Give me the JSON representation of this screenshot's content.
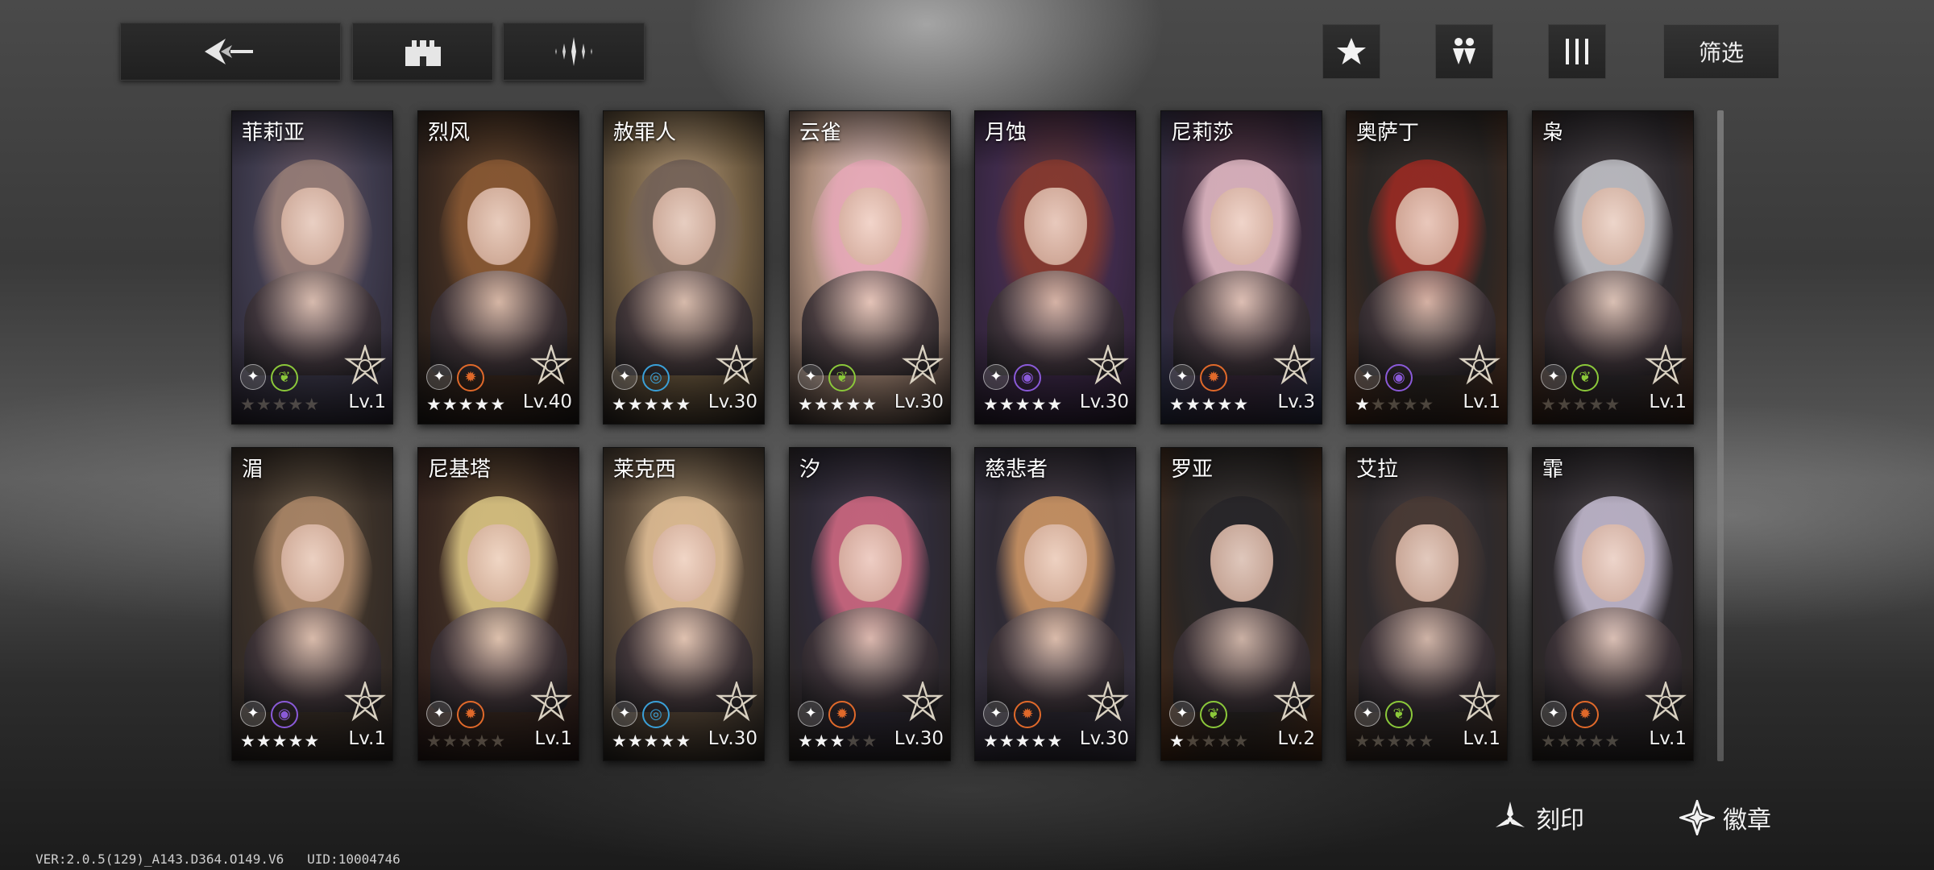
{
  "toolbar": {
    "back_icon": "back-arrow-icon",
    "team_icon": "castle-icon",
    "formation_icon": "sparkle-icon",
    "favorite_icon": "star-icon",
    "sort_icon": "figures-icon",
    "columns_icon": "columns-icon",
    "filter_label": "筛选"
  },
  "characters": [
    {
      "name": "菲莉亚",
      "stars": 5,
      "stars_filled": 0,
      "level": "Lv.1",
      "element": "nature",
      "palette": [
        "#6c5a66",
        "#3d3a4c",
        "#2a2532"
      ],
      "hair": "#9a8078"
    },
    {
      "name": "烈风",
      "stars": 5,
      "stars_filled": 5,
      "level": "Lv.40",
      "element": "fire",
      "palette": [
        "#6a4a30",
        "#3b2a20",
        "#1f1a18"
      ],
      "hair": "#8c5a34"
    },
    {
      "name": "赦罪人",
      "stars": 5,
      "stars_filled": 5,
      "level": "Lv.30",
      "element": "water",
      "palette": [
        "#b59a7a",
        "#6d5a40",
        "#2a2420"
      ],
      "hair": "#6f5e56"
    },
    {
      "name": "云雀",
      "stars": 5,
      "stars_filled": 5,
      "level": "Lv.30",
      "element": "nature",
      "palette": [
        "#e6c6c8",
        "#a88a78",
        "#3a302c"
      ],
      "hair": "#e7a7b7"
    },
    {
      "name": "月蚀",
      "stars": 5,
      "stars_filled": 5,
      "level": "Lv.30",
      "element": "dark",
      "palette": [
        "#6a3a38",
        "#3e2a4a",
        "#2a2030"
      ],
      "hair": "#8a3a2e"
    },
    {
      "name": "尼莉莎",
      "stars": 5,
      "stars_filled": 5,
      "level": "Lv.3",
      "element": "fire",
      "palette": [
        "#5a3a48",
        "#3a2a3c",
        "#2a3048"
      ],
      "hair": "#e9c0cb"
    },
    {
      "name": "奥萨丁",
      "stars": 5,
      "stars_filled": 1,
      "level": "Lv.1",
      "element": "dark",
      "palette": [
        "#3a3230",
        "#2a2624",
        "#4a2a1a"
      ],
      "hair": "#a02a22"
    },
    {
      "name": "枭",
      "stars": 5,
      "stars_filled": 0,
      "level": "Lv.1",
      "element": "nature",
      "palette": [
        "#4a4448",
        "#2e2a2e",
        "#3a2418"
      ],
      "hair": "#c9c9cf"
    },
    {
      "name": "湄",
      "stars": 5,
      "stars_filled": 5,
      "level": "Lv.1",
      "element": "dark",
      "palette": [
        "#6a5a48",
        "#3a3028",
        "#2a2422"
      ],
      "hair": "#b08a6a"
    },
    {
      "name": "尼基塔",
      "stars": 5,
      "stars_filled": 0,
      "level": "Lv.1",
      "element": "fire",
      "palette": [
        "#6a5238",
        "#3a2a22",
        "#2a1a18"
      ],
      "hair": "#e2cc88"
    },
    {
      "name": "莱克西",
      "stars": 5,
      "stars_filled": 5,
      "level": "Lv.30",
      "element": "water",
      "palette": [
        "#a89070",
        "#5a4a3a",
        "#2a2622"
      ],
      "hair": "#e2bf96"
    },
    {
      "name": "汐",
      "stars": 5,
      "stars_filled": 3,
      "level": "Lv.30",
      "element": "fire",
      "palette": [
        "#4a4050",
        "#2e2a36",
        "#2a2420"
      ],
      "hair": "#d66a84"
    },
    {
      "name": "慈悲者",
      "stars": 5,
      "stars_filled": 5,
      "level": "Lv.30",
      "element": "fire",
      "palette": [
        "#4a4048",
        "#2e2a34",
        "#3a3444"
      ],
      "hair": "#d49a66"
    },
    {
      "name": "罗亚",
      "stars": 5,
      "stars_filled": 1,
      "level": "Lv.2",
      "element": "nature",
      "palette": [
        "#3a3636",
        "#2a2624",
        "#4a2a16"
      ],
      "hair": "#262428"
    },
    {
      "name": "艾拉",
      "stars": 5,
      "stars_filled": 0,
      "level": "Lv.1",
      "element": "nature",
      "palette": [
        "#4a4042",
        "#2e2a2c",
        "#3a2a20"
      ],
      "hair": "#4a3a34"
    },
    {
      "name": "霏",
      "stars": 5,
      "stars_filled": 0,
      "level": "Lv.1",
      "element": "fire",
      "palette": [
        "#4a4448",
        "#2e2a2e",
        "#2a2420"
      ],
      "hair": "#c9c0d6"
    }
  ],
  "element_colors": {
    "fire": "#e0692a",
    "water": "#3aa0d8",
    "nature": "#8bc83a",
    "dark": "#8a5ad8"
  },
  "element_glyphs": {
    "fire": "✹",
    "water": "◎",
    "nature": "❦",
    "dark": "◉"
  },
  "actions": {
    "engrave_label": "刻印",
    "engrave_icon": "engrave-icon",
    "badge_label": "徽章",
    "badge_icon": "badge-icon"
  },
  "footer": {
    "version": "VER:2.0.5(129)_A143.D364.O149.V6",
    "uid": "UID:10004746"
  }
}
